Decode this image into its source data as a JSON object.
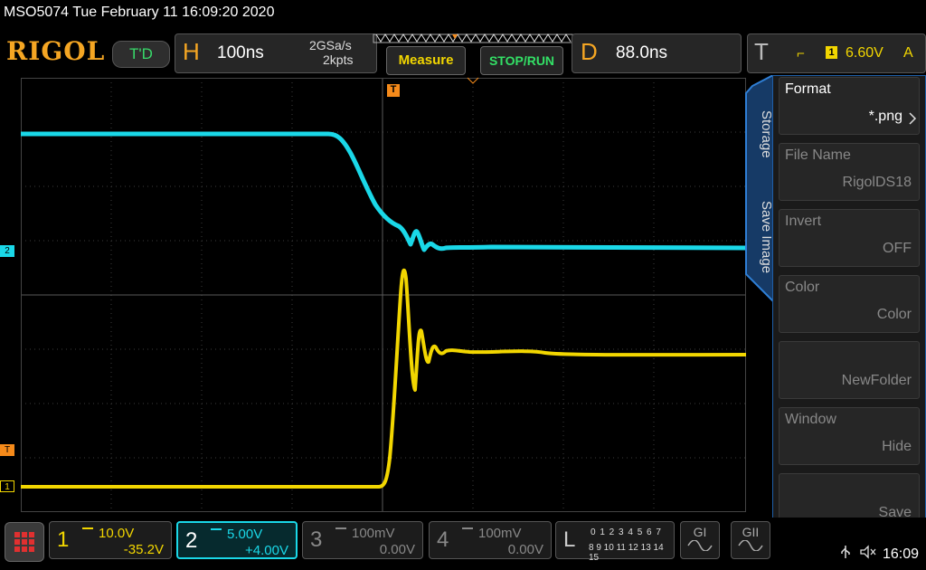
{
  "title_bar": {
    "text": "MSO5074  Tue February 11 16:09:20 2020"
  },
  "logo": "RIGOL",
  "trigger_status": "T'D",
  "horizontal": {
    "letter": "H",
    "timebase": "100ns",
    "sample_rate": "2GSa/s",
    "points": "2kpts"
  },
  "buttons": {
    "measure": "Measure",
    "stop_run": "STOP/RUN"
  },
  "delay": {
    "letter": "D",
    "value": "88.0ns"
  },
  "trigger": {
    "letter": "T",
    "edge_icon": "rising-edge-icon",
    "edge_glyph": "⌐",
    "source": "1",
    "level": "6.60V",
    "mode": "A"
  },
  "markers": {
    "ch2": "2",
    "trig_level": "T",
    "ch1": "1",
    "trig_pos": "T"
  },
  "side_menu": {
    "tab_storage": "Storage",
    "tab_save_image": "Save Image",
    "items": [
      {
        "label": "Format",
        "value": "*.png",
        "enabled": true
      },
      {
        "label": "File Name",
        "value": "RigolDS18",
        "enabled": false
      },
      {
        "label": "Invert",
        "value": "OFF",
        "enabled": false
      },
      {
        "label": "Color",
        "value": "Color",
        "enabled": false
      },
      {
        "label": "",
        "value": "NewFolder",
        "enabled": false
      },
      {
        "label": "Window",
        "value": "Hide",
        "enabled": false
      },
      {
        "label": "",
        "value": "Save",
        "enabled": false
      }
    ]
  },
  "channels": [
    {
      "num": "1",
      "scale": "10.0V",
      "offset": "-35.2V",
      "color": "#f2d600",
      "active": false
    },
    {
      "num": "2",
      "scale": "5.00V",
      "offset": "+4.00V",
      "color": "#1ad8e8",
      "active": true
    },
    {
      "num": "3",
      "scale": "100mV",
      "offset": "0.00V",
      "color": "#888888",
      "active": false
    },
    {
      "num": "4",
      "scale": "100mV",
      "offset": "0.00V",
      "color": "#888888",
      "active": false
    }
  ],
  "la": {
    "letter": "L",
    "row1": "0 1 2 3  4 5 6 7",
    "row2": "8 9 10 11 12 13 14 15"
  },
  "gen_buttons": {
    "g1": "GI",
    "g2": "GII"
  },
  "status": {
    "time": "16:09"
  },
  "colors": {
    "ch1": "#f2d600",
    "ch2": "#1ad8e8",
    "trigger": "#f58a1a",
    "accent": "#f5a623"
  }
}
